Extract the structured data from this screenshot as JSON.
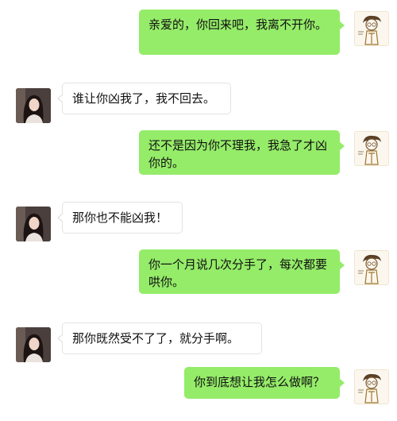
{
  "colors": {
    "sent_bubble": "#95ec69",
    "received_bubble": "#ffffff",
    "text": "#111111"
  },
  "avatars": {
    "me": "cartoon-man-avatar-icon",
    "partner": "woman-photo-avatar"
  },
  "messages": [
    {
      "sender": "me",
      "text": "亲爱的，你回来吧，我离不开你。"
    },
    {
      "sender": "partner",
      "text": "谁让你凶我了，我不回去。"
    },
    {
      "sender": "me",
      "text": "还不是因为你不理我，我急了才凶你的。"
    },
    {
      "sender": "partner",
      "text": "那你也不能凶我！"
    },
    {
      "sender": "me",
      "text": "你一个月说几次分手了，每次都要哄你。"
    },
    {
      "sender": "partner",
      "text": "那你既然受不了了，就分手啊。"
    },
    {
      "sender": "me",
      "text": "你到底想让我怎么做啊？"
    }
  ]
}
